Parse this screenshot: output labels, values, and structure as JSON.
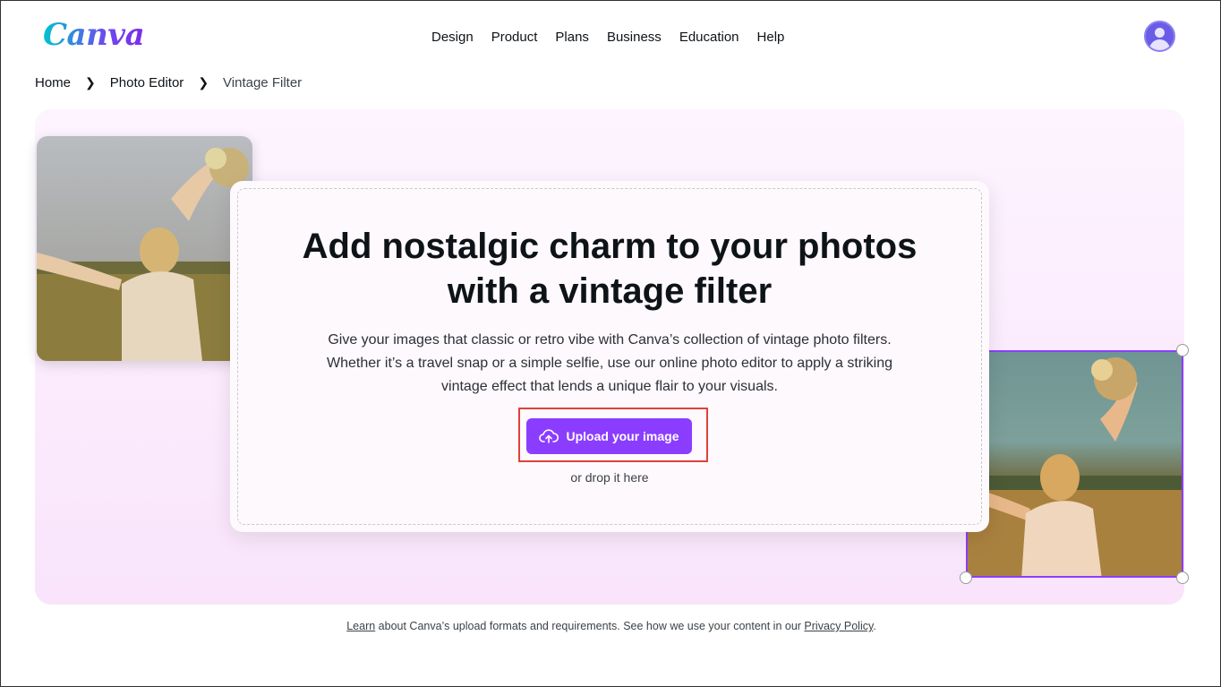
{
  "header": {
    "logo_text": "Canva",
    "nav": [
      "Design",
      "Product",
      "Plans",
      "Business",
      "Education",
      "Help"
    ]
  },
  "breadcrumb": [
    "Home",
    "Photo Editor",
    "Vintage Filter"
  ],
  "hero": {
    "headline_line1": "Add nostalgic charm to your photos",
    "headline_line2": "with a vintage filter",
    "description_line1": "Give your images that classic or retro vibe with Canva’s collection of vintage photo filters.",
    "description_line2": "Whether it’s a travel snap or a simple selfie, use our online photo editor to apply a striking",
    "description_line3": "vintage effect that lends a unique flair to your visuals.",
    "upload_label": "Upload your image",
    "drop_label": "or drop it here"
  },
  "footnote": {
    "learn_link": "Learn",
    "text_mid": " about Canva’s upload formats and requirements. See how we use your content in our ",
    "privacy_link": "Privacy Policy",
    "text_end": "."
  },
  "colors": {
    "brand_purple": "#8b3dff",
    "highlight_red": "#e0413a"
  }
}
